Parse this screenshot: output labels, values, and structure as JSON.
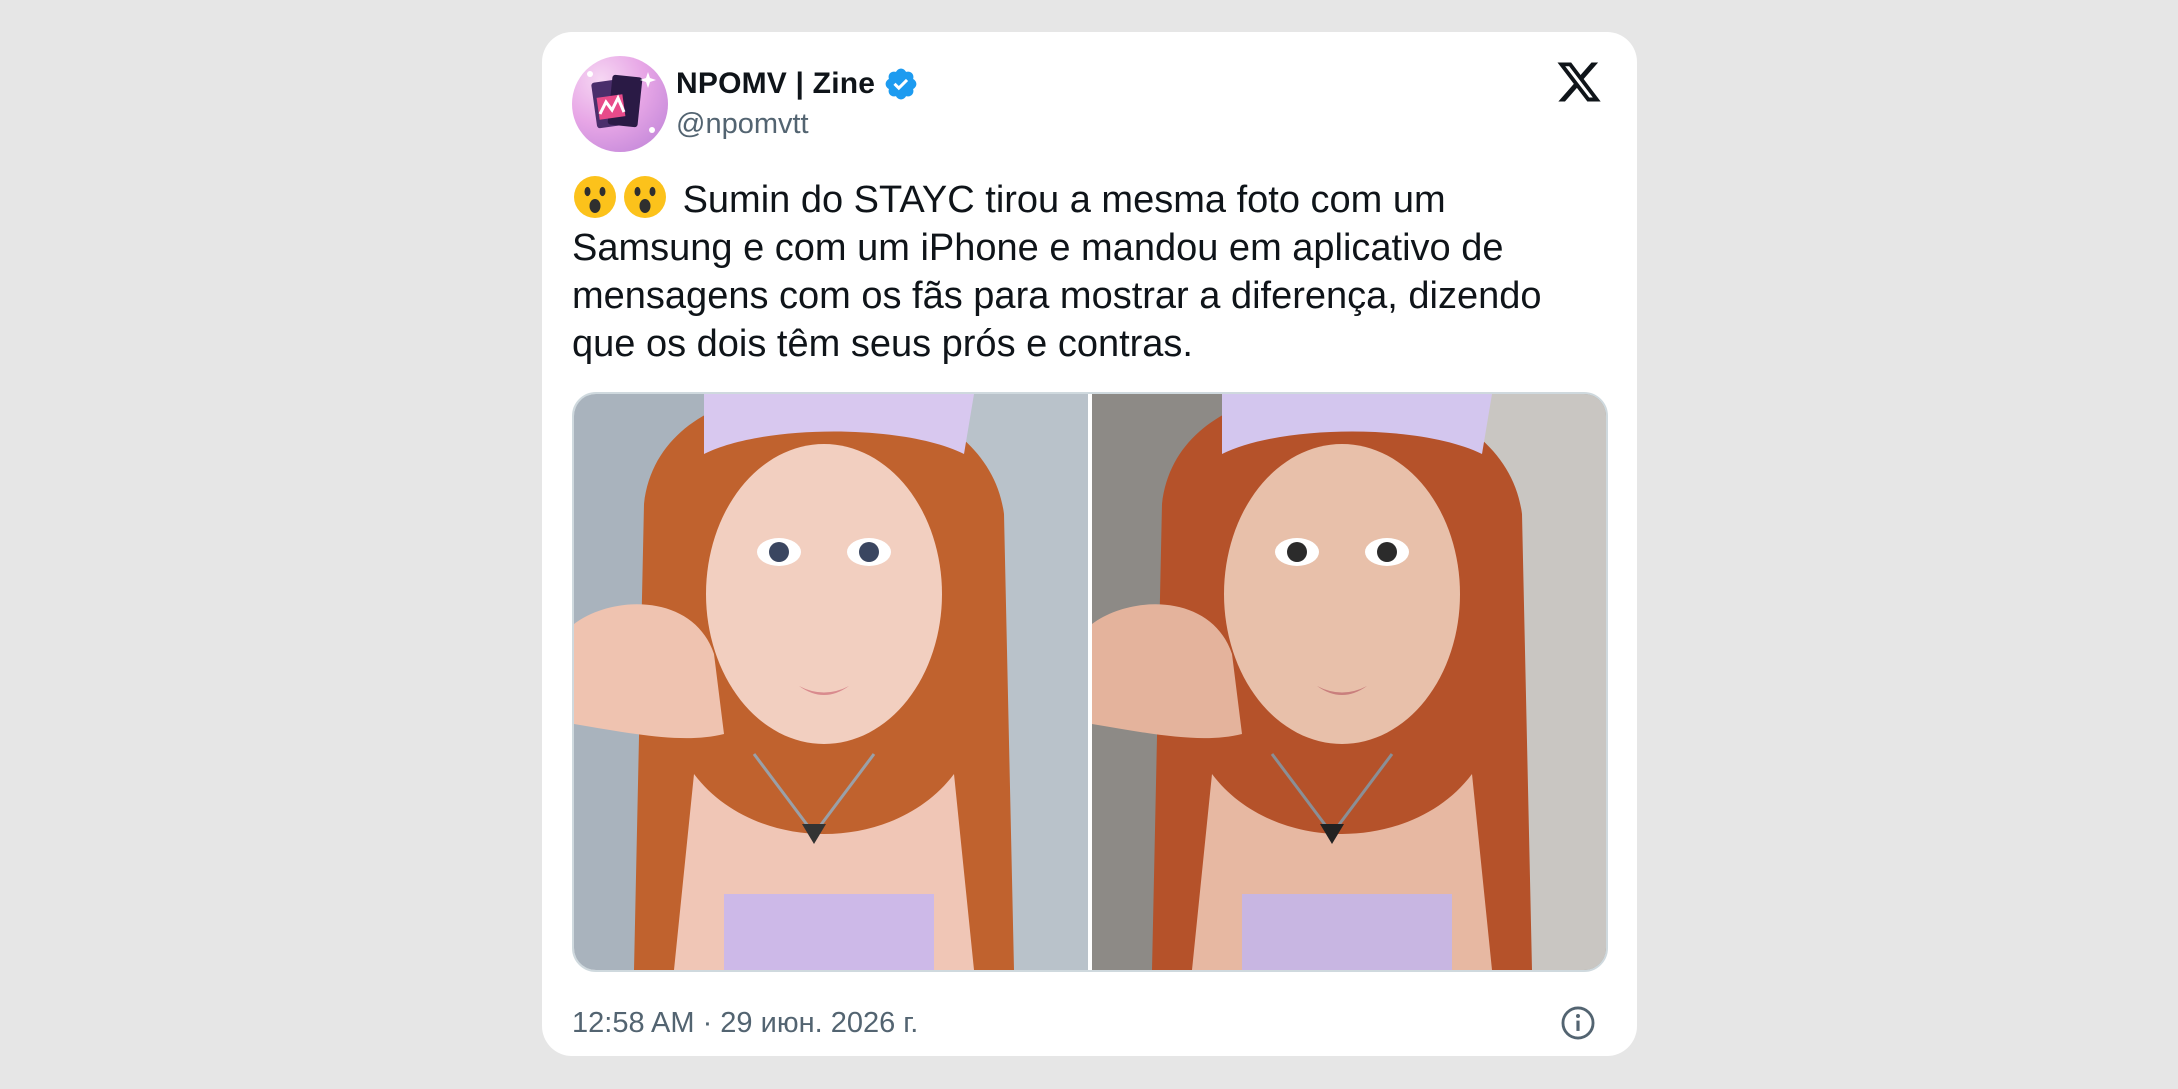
{
  "author": {
    "name": "NPOMV | Zine",
    "handle": "@npomvtt",
    "verified": true,
    "avatar_icon": "avatar-logo-icon"
  },
  "platform_icon": "x-logo-icon",
  "tweet": {
    "text": "Sumin do STAYC tirou a mesma foto com um Samsung e com um iPhone e mandou em aplicativo de mensagens com os fãs para mostrar a diferença, dizendo que os dois têm seus prós e contras.",
    "emojis": [
      "astonished-face",
      "astonished-face"
    ],
    "media": [
      {
        "name": "photo-samsung"
      },
      {
        "name": "photo-iphone"
      }
    ]
  },
  "timestamp": "12:58 AM · 29 июн. 2026 г.",
  "colors": {
    "text_primary": "#0f1419",
    "text_secondary": "#536471",
    "verified_blue": "#1d9bf0",
    "background": "#e6e6e6",
    "card": "#ffffff"
  }
}
